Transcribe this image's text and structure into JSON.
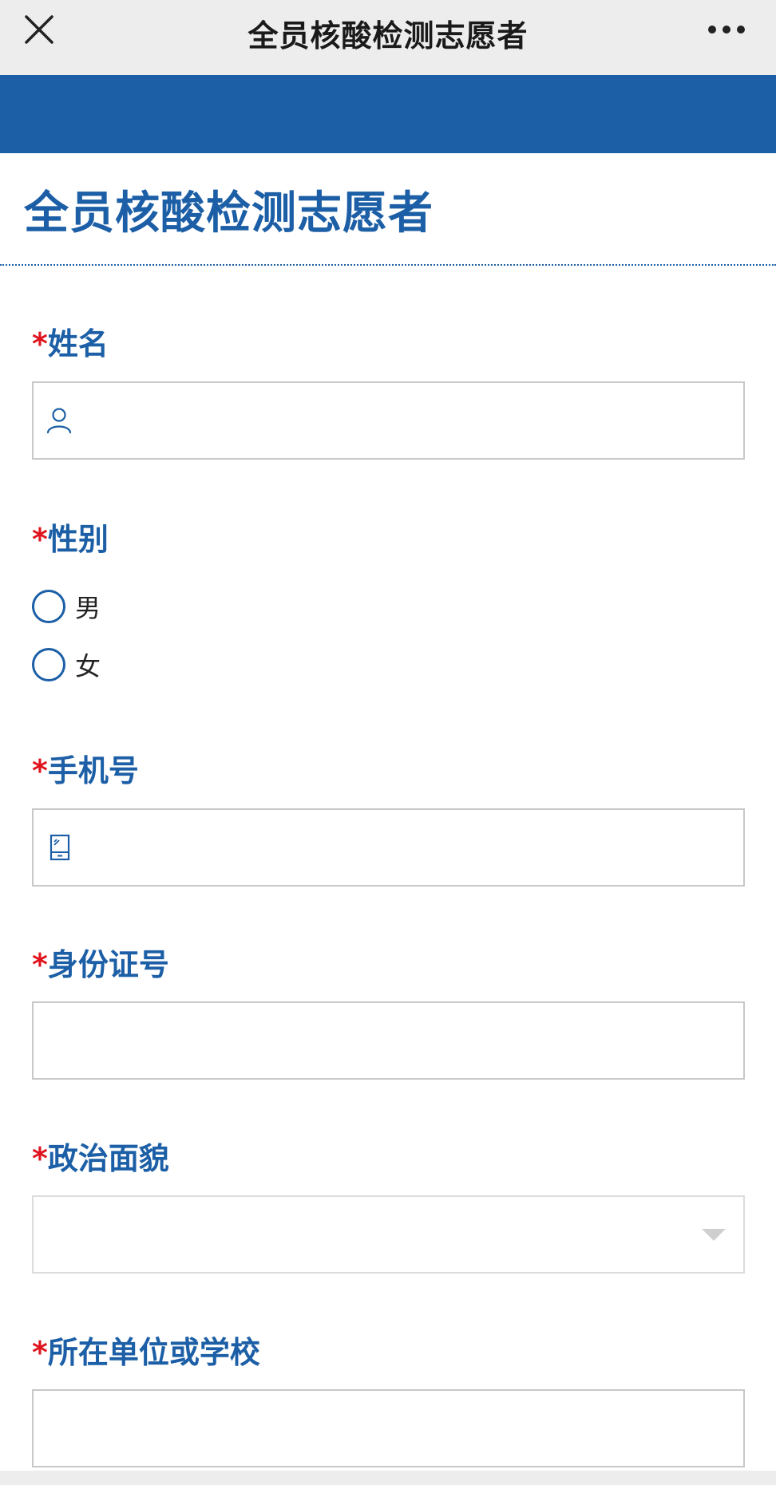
{
  "header": {
    "title": "全员核酸检测志愿者"
  },
  "form": {
    "title": "全员核酸检测志愿者",
    "required_mark": "*",
    "fields": {
      "name": {
        "label": "姓名",
        "value": ""
      },
      "gender": {
        "label": "性别",
        "options": [
          "男",
          "女"
        ]
      },
      "phone": {
        "label": "手机号",
        "value": ""
      },
      "id_number": {
        "label": "身份证号",
        "value": ""
      },
      "political_status": {
        "label": "政治面貌",
        "value": ""
      },
      "organization": {
        "label": "所在单位或学校",
        "value": ""
      }
    }
  },
  "colors": {
    "accent": "#1c5fa6",
    "required": "#e0141e",
    "topbar": "#ededed"
  }
}
